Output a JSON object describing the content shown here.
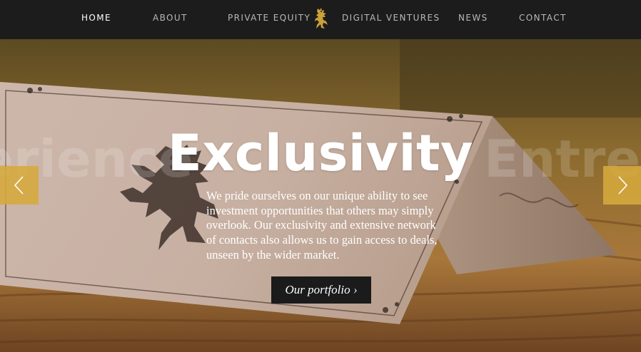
{
  "nav": {
    "items": [
      {
        "label": "HOME",
        "active": true
      },
      {
        "label": "ABOUT",
        "active": false
      },
      {
        "label": "PRIVATE EQUITY",
        "active": false
      },
      {
        "label": "DIGITAL VENTURES",
        "active": false
      },
      {
        "label": "NEWS",
        "active": false
      },
      {
        "label": "CONTACT",
        "active": false
      }
    ],
    "logo_icon": "lion-rampant-icon"
  },
  "hero": {
    "ghost_left": "erience",
    "ghost_right": "Entrep",
    "headline": "Exclusivity",
    "body": "We pride ourselves on our unique ability to see investment opportunities that others may simply overlook. Our exclusivity and extensive network of contacts also allows us to gain access to deals, unseen by the wider market.",
    "cta_label": "Our portfolio ›",
    "prev_icon": "chevron-left-icon",
    "next_icon": "chevron-right-icon"
  },
  "colors": {
    "nav_bg": "#1c1c1c",
    "accent_gold": "#d6aa3c",
    "button_bg": "#1b1b1b"
  }
}
